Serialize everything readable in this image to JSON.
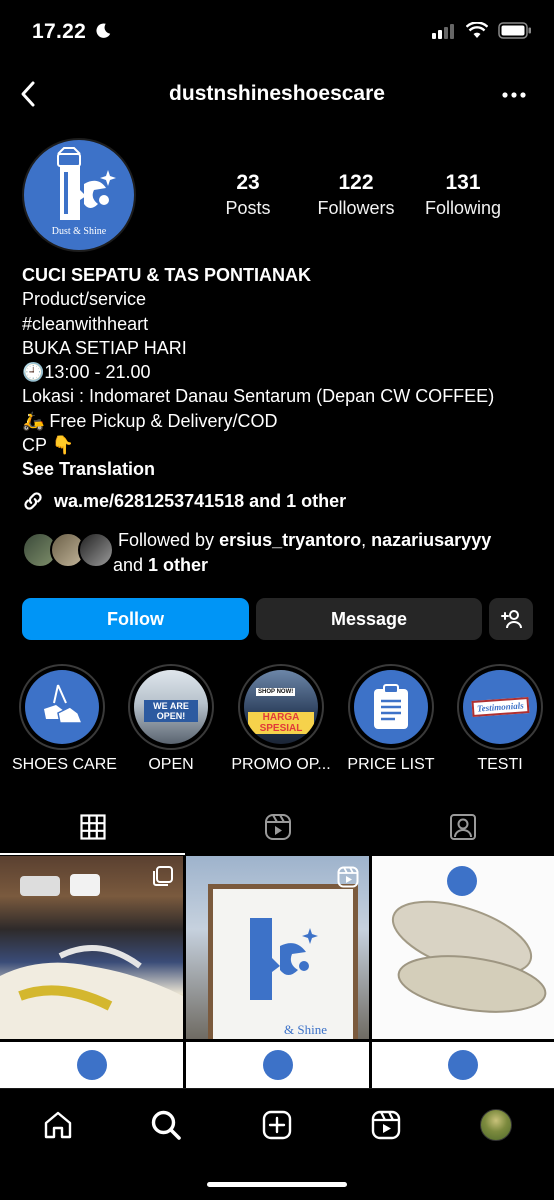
{
  "status": {
    "time": "17.22"
  },
  "nav": {
    "title": "dustnshineshoescare"
  },
  "profile": {
    "avatar_text": "Dust & Shine",
    "stats": [
      {
        "value": "23",
        "label": "Posts"
      },
      {
        "value": "122",
        "label": "Followers"
      },
      {
        "value": "131",
        "label": "Following"
      }
    ]
  },
  "bio": {
    "name": "CUCI SEPATU & TAS PONTIANAK",
    "category": "Product/service",
    "lines": [
      "#cleanwithheart",
      "BUKA SETIAP HARI",
      "🕘13:00 - 21.00",
      "Lokasi : Indomaret Danau Sentarum (Depan CW COFFEE)",
      "🛵 Free Pickup & Delivery/COD",
      "CP 👇"
    ],
    "see_translation": "See Translation"
  },
  "link": {
    "text": "wa.me/6281253741518 and 1 other"
  },
  "followed_by": {
    "prefix": "Followed by ",
    "user1": "ersius_tryantoro",
    "sep": ", ",
    "user2": "nazariusaryyy",
    "and": " and ",
    "others": "1 other"
  },
  "actions": {
    "follow": "Follow",
    "message": "Message"
  },
  "highlights": [
    {
      "label": "SHOES CARE"
    },
    {
      "label": "OPEN",
      "overlay": "WE ARE OPEN!"
    },
    {
      "label": "PROMO OP...",
      "overlay": "HARGA SPESIAL",
      "badge": "SHOP NOW!"
    },
    {
      "label": "PRICE LIST"
    },
    {
      "label": "TESTI",
      "overlay": "Testimonials"
    }
  ],
  "grid_posts": [
    {
      "caption": ""
    },
    {
      "caption": "& Shine"
    },
    {
      "caption": ""
    }
  ],
  "colors": {
    "accent": "#0095f6",
    "brand": "#3d72c8",
    "button_dark": "#262626"
  }
}
